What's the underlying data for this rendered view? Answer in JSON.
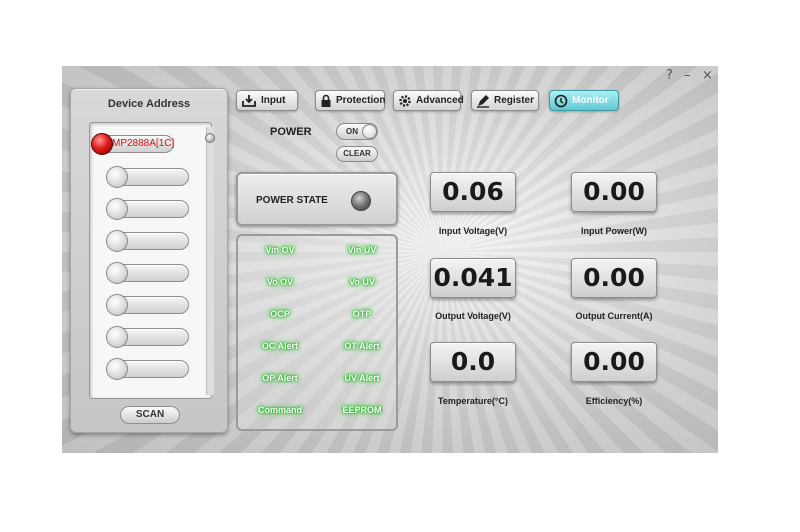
{
  "window": {
    "help": "?",
    "minimize": "–",
    "close": "×"
  },
  "device": {
    "title": "Device Address",
    "slots": [
      {
        "label": "MP2888A[1C]",
        "active": true
      },
      {
        "label": "",
        "active": false
      },
      {
        "label": "",
        "active": false
      },
      {
        "label": "",
        "active": false
      },
      {
        "label": "",
        "active": false
      },
      {
        "label": "",
        "active": false
      },
      {
        "label": "",
        "active": false
      },
      {
        "label": "",
        "active": false
      }
    ],
    "scan_label": "SCAN"
  },
  "tabs": [
    {
      "label": "Input",
      "icon": "input-icon"
    },
    {
      "label": "Protection",
      "icon": "lock-icon"
    },
    {
      "label": "Advanced",
      "icon": "gear-icon"
    },
    {
      "label": "Register",
      "icon": "pen-icon"
    },
    {
      "label": "Monitor",
      "icon": "clock-icon",
      "active": true
    }
  ],
  "power": {
    "label": "POWER",
    "toggle_label": "ON",
    "clear_label": "CLEAR",
    "state_label": "POWER STATE"
  },
  "alerts": [
    [
      "Vin OV",
      "Vin UV"
    ],
    [
      "Vo OV",
      "Vo UV"
    ],
    [
      "OCP",
      "OTP"
    ],
    [
      "OC Alert",
      "OT Alert"
    ],
    [
      "OP Alert",
      "UV Alert"
    ],
    [
      "Command",
      "EEPROM"
    ]
  ],
  "readouts": [
    {
      "value": "0.06",
      "label": "Input Voltage(V)"
    },
    {
      "value": "0.00",
      "label": "Input Power(W)"
    },
    {
      "value": "0.041",
      "label": "Output Voltage(V)"
    },
    {
      "value": "0.00",
      "label": "Output Current(A)"
    },
    {
      "value": "0.0",
      "label": "Temperature(°C)"
    },
    {
      "value": "0.00",
      "label": "Efficiency(%)"
    }
  ],
  "colors": {
    "accent_tab": "#60c8d0",
    "alert_glow": "#27c227",
    "device_led_active": "#e01b1b"
  }
}
